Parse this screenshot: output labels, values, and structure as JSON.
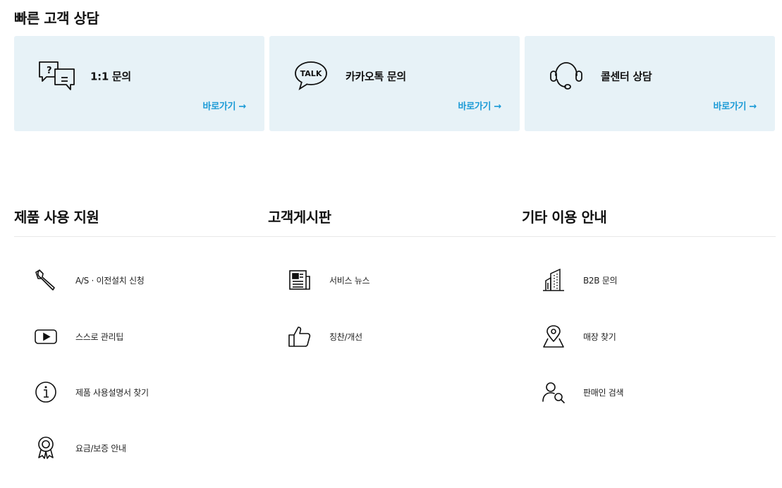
{
  "quick": {
    "title": "빠른 고객 상담",
    "cards": [
      {
        "label": "1:1 문의",
        "go": "바로가기 →",
        "icon": "chat-question-icon"
      },
      {
        "label": "카카오톡 문의",
        "go": "바로가기 →",
        "icon": "kakaotalk-icon",
        "icon_text": "TALK"
      },
      {
        "label": "콜센터 상담",
        "go": "바로가기 →",
        "icon": "headset-icon"
      }
    ]
  },
  "sections": [
    {
      "title": "제품 사용 지원",
      "items": [
        {
          "label": "A/S · 이전설치 신청",
          "icon": "wrench-icon"
        },
        {
          "label": "스스로 관리팁",
          "icon": "video-play-icon"
        },
        {
          "label": "제품 사용설명서 찾기",
          "icon": "info-icon"
        },
        {
          "label": "요금/보증 안내",
          "icon": "award-ribbon-icon"
        }
      ]
    },
    {
      "title": "고객게시판",
      "items": [
        {
          "label": "서비스 뉴스",
          "icon": "newspaper-icon"
        },
        {
          "label": "칭찬/개선",
          "icon": "thumbs-up-icon"
        }
      ]
    },
    {
      "title": "기타 이용 안내",
      "items": [
        {
          "label": "B2B 문의",
          "icon": "building-icon"
        },
        {
          "label": "매장 찾기",
          "icon": "map-pin-icon"
        },
        {
          "label": "판매인 검색",
          "icon": "person-search-icon"
        }
      ]
    }
  ],
  "colors": {
    "card_bg": "#e7f2f7",
    "accent": "#1a9ad6",
    "text": "#111111"
  }
}
